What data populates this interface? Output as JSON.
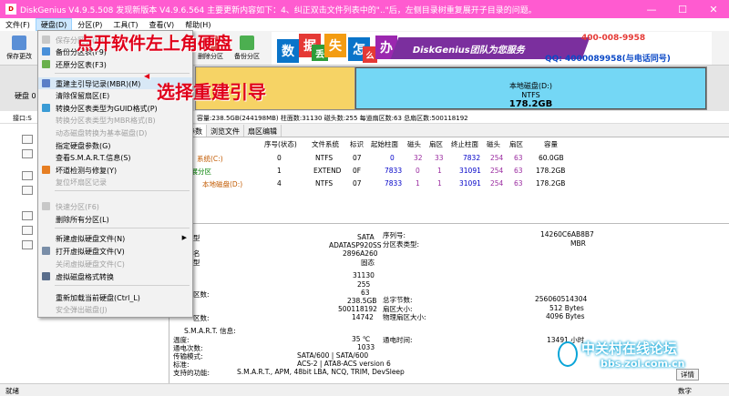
{
  "window": {
    "title": "DiskGenius V4.9.5.508   发现新版本 V4.9.6.564 主要更新内容如下：4、纠正双击文件列表中的\"..\"后，左侧目录树重复展开子目录的问题。",
    "app_icon": "D"
  },
  "menubar": {
    "items": [
      "文件(F)",
      "硬盘(D)",
      "分区(P)",
      "工具(T)",
      "查看(V)",
      "帮助(H)"
    ]
  },
  "toolbar": {
    "save_label": "保存更改",
    "hidden_buttons": [
      "删除分区",
      "备份分区"
    ]
  },
  "banner": {
    "glyphs": [
      "数",
      "据",
      "丢",
      "失",
      "怎",
      "么",
      "办"
    ],
    "glyph_colors": [
      "#0a74c9",
      "#e53935",
      "#2e9d3a",
      "#f39c12",
      "#0a74c9",
      "#e53935",
      "#9b27af"
    ],
    "ribbon": "DiskGenius团队为您服务",
    "phone": "400-008-9958",
    "qq": "QQ: 4000089958(与电话同号)"
  },
  "left_labels": {
    "disk": "硬盘 0",
    "port": "接口:S"
  },
  "diskmap": {
    "partition_name": "本地磁盘(D:)",
    "fs": "NTFS",
    "size": "178.2GB"
  },
  "infoline": "容量:238.5GB(244198MB)  柱面数:31130  磁头数:255  每道扇区数:63  总扇区数:500118192",
  "tabs": [
    "分区参数",
    "浏览文件",
    "扇区编辑"
  ],
  "partition_table": {
    "headers": [
      "序号(状态)",
      "文件系统",
      "标识",
      "起始柱面",
      "磁头",
      "扇区",
      "终止柱面",
      "磁头",
      "扇区",
      "容量"
    ],
    "rows": [
      {
        "name": "系统(C:)",
        "cells": [
          "0",
          "NTFS",
          "07",
          "0",
          "32",
          "33",
          "7832",
          "254",
          "63",
          "60.0GB"
        ]
      },
      {
        "name": "扩展分区",
        "cells": [
          "1",
          "EXTEND",
          "0F",
          "7833",
          "0",
          "1",
          "31091",
          "254",
          "63",
          "178.2GB"
        ]
      },
      {
        "name": "本地磁盘(D:)",
        "cells": [
          "4",
          "NTFS",
          "07",
          "7833",
          "1",
          "1",
          "31091",
          "254",
          "63",
          "178.2GB"
        ]
      }
    ]
  },
  "details": {
    "left_values": [
      "SATA",
      "ADATASP920SS",
      "2896A260",
      "固态",
      "31130",
      "255",
      "63",
      "238.5GB",
      "500118192",
      "14742"
    ],
    "left_labels": [
      "型",
      "名",
      "型"
    ],
    "right_labels": [
      "序列号:",
      "分区表类型:",
      "总字节数:",
      "扇区大小:",
      "物理扇区大小:"
    ],
    "right_values": [
      "14260C6AB8B7",
      "MBR",
      "256060514304",
      "512 Bytes",
      "4096 Bytes"
    ],
    "mid_labels": [
      "区数:",
      "区数:"
    ],
    "smart_title": "S.M.A.R.T. 信息:",
    "smart_labels": [
      "温度:",
      "通电次数:",
      "传输模式:",
      "标准:",
      "支持的功能:"
    ],
    "smart_values": [
      "35 ℃",
      "1033",
      "SATA/600 | SATA/600",
      "ACS-2 | ATA8-ACS version 6",
      "S.M.A.R.T., APM, 48bit LBA, NCQ, TRIM, DevSleep"
    ],
    "power_label": "通电时间:",
    "power_value": "13491 小时",
    "detail_button": "详情"
  },
  "statusbar": {
    "left": "就绪",
    "right": "数字"
  },
  "dropdown": {
    "items": [
      {
        "label": "保存分区表(F8)",
        "disabled": true
      },
      {
        "label": "备份分区表(F9)",
        "disabled": false
      },
      {
        "label": "还原分区表(F3)",
        "disabled": false
      },
      {
        "label": "重建主引导记录(MBR)(M)",
        "disabled": false
      },
      {
        "label": "清除保留扇区(E)",
        "disabled": false
      },
      {
        "label": "转换分区表类型为GUID格式(P)",
        "disabled": false
      },
      {
        "label": "转换分区表类型为MBR格式(B)",
        "disabled": true
      },
      {
        "label": "动态磁盘转换为基本磁盘(D)",
        "disabled": true
      },
      {
        "label": "指定硬盘参数(G)",
        "disabled": false
      },
      {
        "label": "查看S.M.A.R.T.信息(S)",
        "disabled": false
      },
      {
        "label": "坏道检测与修复(Y)",
        "disabled": false
      },
      {
        "label": "复位坏扇区记录",
        "disabled": true
      },
      {
        "label": "快速分区(F6)",
        "disabled": true
      },
      {
        "label": "删除所有分区(L)",
        "disabled": false
      },
      {
        "label": "新建虚拟硬盘文件(N)",
        "disabled": false
      },
      {
        "label": "打开虚拟硬盘文件(V)",
        "disabled": false
      },
      {
        "label": "关闭虚拟硬盘文件(C)",
        "disabled": true
      },
      {
        "label": "虚拟磁盘格式转换",
        "disabled": false
      },
      {
        "label": "重新加载当前硬盘(Ctrl_L)",
        "disabled": false
      },
      {
        "label": "安全弹出磁盘(J)",
        "disabled": true
      }
    ]
  },
  "annotations": {
    "top": "点开软件左上角硬盘",
    "mid": "选择重建引导"
  },
  "watermark": {
    "cn": "中关村在线论坛",
    "url": "bbs.zol.com.cn"
  }
}
